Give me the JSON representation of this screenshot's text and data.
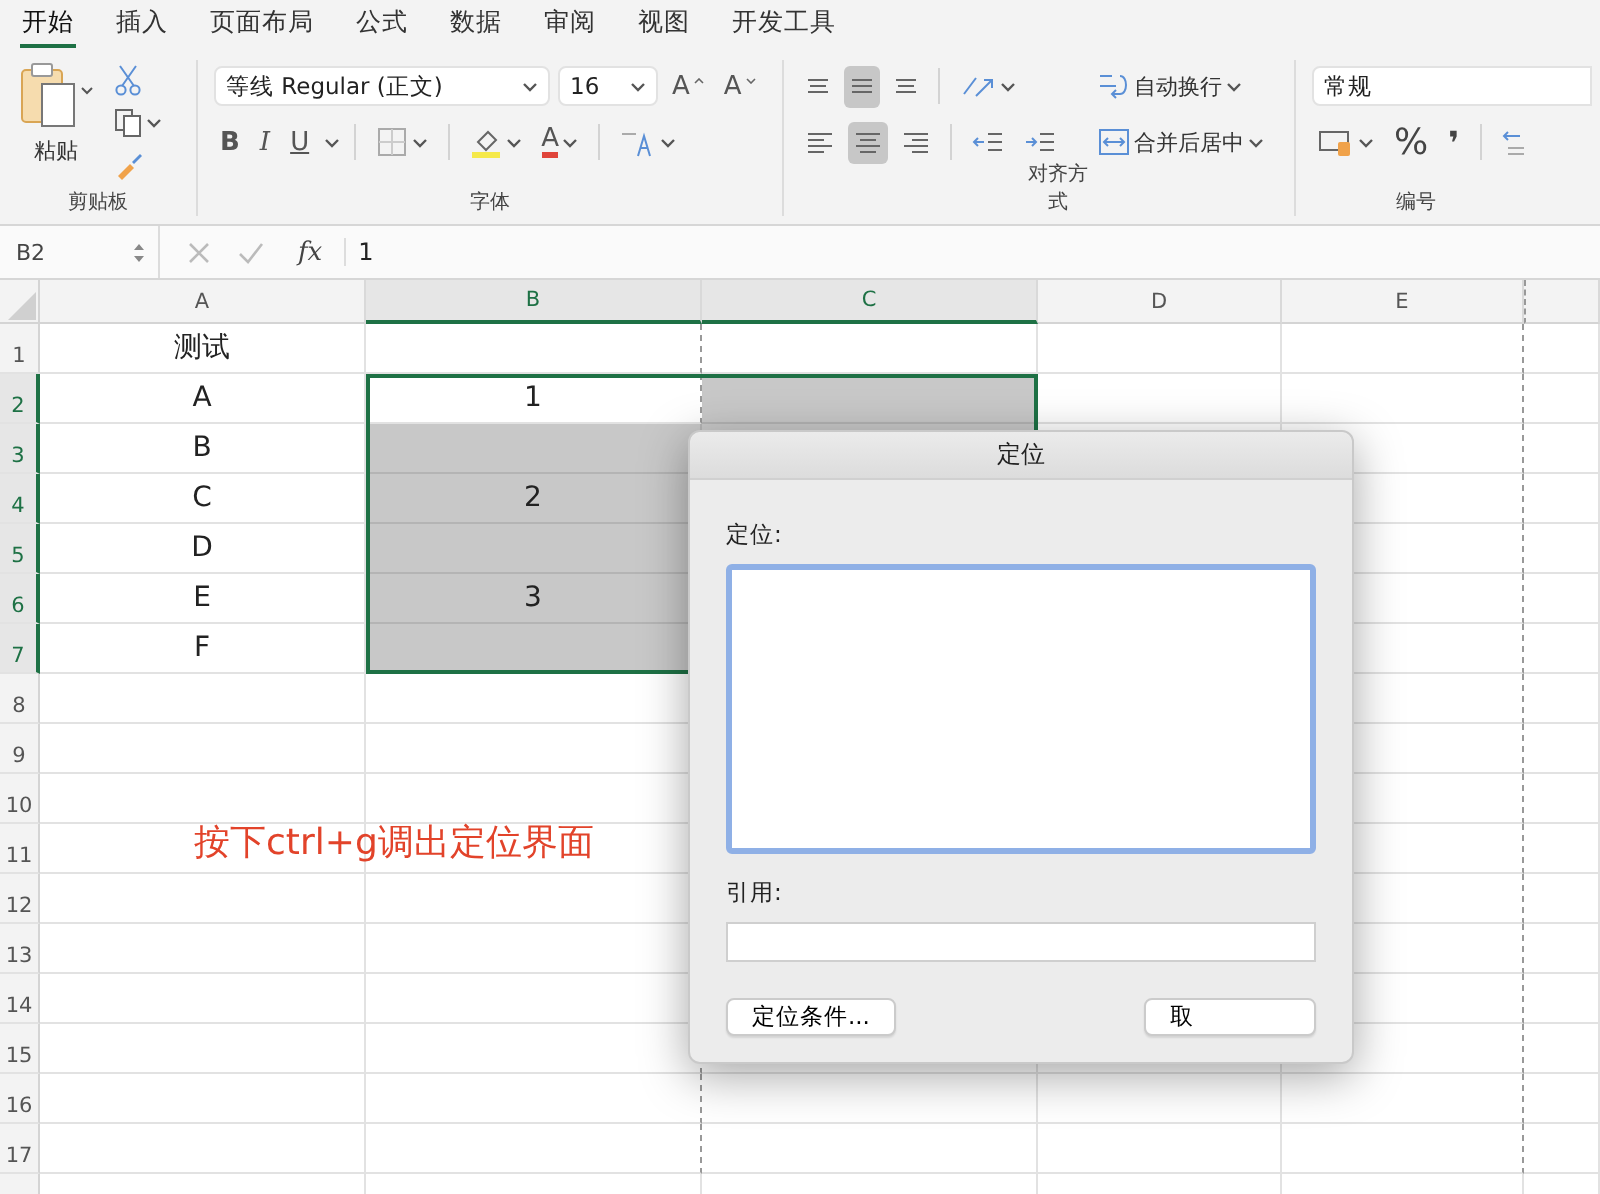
{
  "tabs": [
    {
      "label": "开始",
      "selected": true
    },
    {
      "label": "插入",
      "selected": false
    },
    {
      "label": "页面布局",
      "selected": false
    },
    {
      "label": "公式",
      "selected": false
    },
    {
      "label": "数据",
      "selected": false
    },
    {
      "label": "审阅",
      "selected": false
    },
    {
      "label": "视图",
      "selected": false
    },
    {
      "label": "开发工具",
      "selected": false
    }
  ],
  "ribbon": {
    "clipboard": {
      "label": "剪贴板",
      "paste": "粘贴"
    },
    "font": {
      "label": "字体",
      "family": "等线 Regular (正文)",
      "size": "16",
      "size_buttons": [
        {
          "kind": "grow",
          "glyph": "A"
        },
        {
          "kind": "shrink",
          "glyph": "A"
        }
      ],
      "styles": [
        {
          "kind": "bold",
          "glyph": "B"
        },
        {
          "kind": "italic",
          "glyph": "I"
        },
        {
          "kind": "underline",
          "glyph": "U"
        }
      ],
      "font_color": "A"
    },
    "alignment": {
      "label": "对齐方式",
      "vertical": [
        {
          "kind": "top",
          "selected": false
        },
        {
          "kind": "middle",
          "selected": true
        },
        {
          "kind": "bottom",
          "selected": false
        }
      ],
      "horizontal": [
        {
          "kind": "left",
          "selected": false
        },
        {
          "kind": "center",
          "selected": true
        },
        {
          "kind": "right",
          "selected": false
        }
      ],
      "wrap": "自动换行",
      "merge": "合并后居中"
    },
    "number": {
      "label": "编号",
      "format": "常规",
      "percent": "%",
      "comma": "❜"
    }
  },
  "formula_bar": {
    "cell": "B2",
    "fx": "fx",
    "value": "1"
  },
  "sheet": {
    "columns": [
      {
        "label": "A",
        "selected": false
      },
      {
        "label": "B",
        "selected": true
      },
      {
        "label": "C",
        "selected": true
      },
      {
        "label": "D",
        "selected": false
      },
      {
        "label": "E",
        "selected": false
      }
    ],
    "rows": [
      {
        "number": "1",
        "selected": false,
        "cell_a": "测试"
      },
      {
        "number": "2",
        "selected": true,
        "active": true,
        "cell_a": "A",
        "cell_b": "1"
      },
      {
        "number": "3",
        "selected": true,
        "cell_a": "B"
      },
      {
        "number": "4",
        "selected": true,
        "cell_a": "C",
        "cell_b": "2"
      },
      {
        "number": "5",
        "selected": true,
        "cell_a": "D"
      },
      {
        "number": "6",
        "selected": true,
        "cell_a": "E",
        "cell_b": "3"
      },
      {
        "number": "7",
        "selected": true,
        "cell_a": "F"
      },
      {
        "number": "8",
        "selected": false
      },
      {
        "number": "9",
        "selected": false
      },
      {
        "number": "10",
        "selected": false
      },
      {
        "number": "11",
        "selected": false
      },
      {
        "number": "12",
        "selected": false
      },
      {
        "number": "13",
        "selected": false
      },
      {
        "number": "14",
        "selected": false
      },
      {
        "number": "15",
        "selected": false
      },
      {
        "number": "16",
        "selected": false
      },
      {
        "number": "17",
        "selected": false
      }
    ]
  },
  "annotation": "按下ctrl+g调出定位界面",
  "dialog": {
    "title": "定位",
    "list_label": "定位:",
    "reference_label": "引用:",
    "buttons": [
      "定位条件...",
      "取"
    ]
  }
}
